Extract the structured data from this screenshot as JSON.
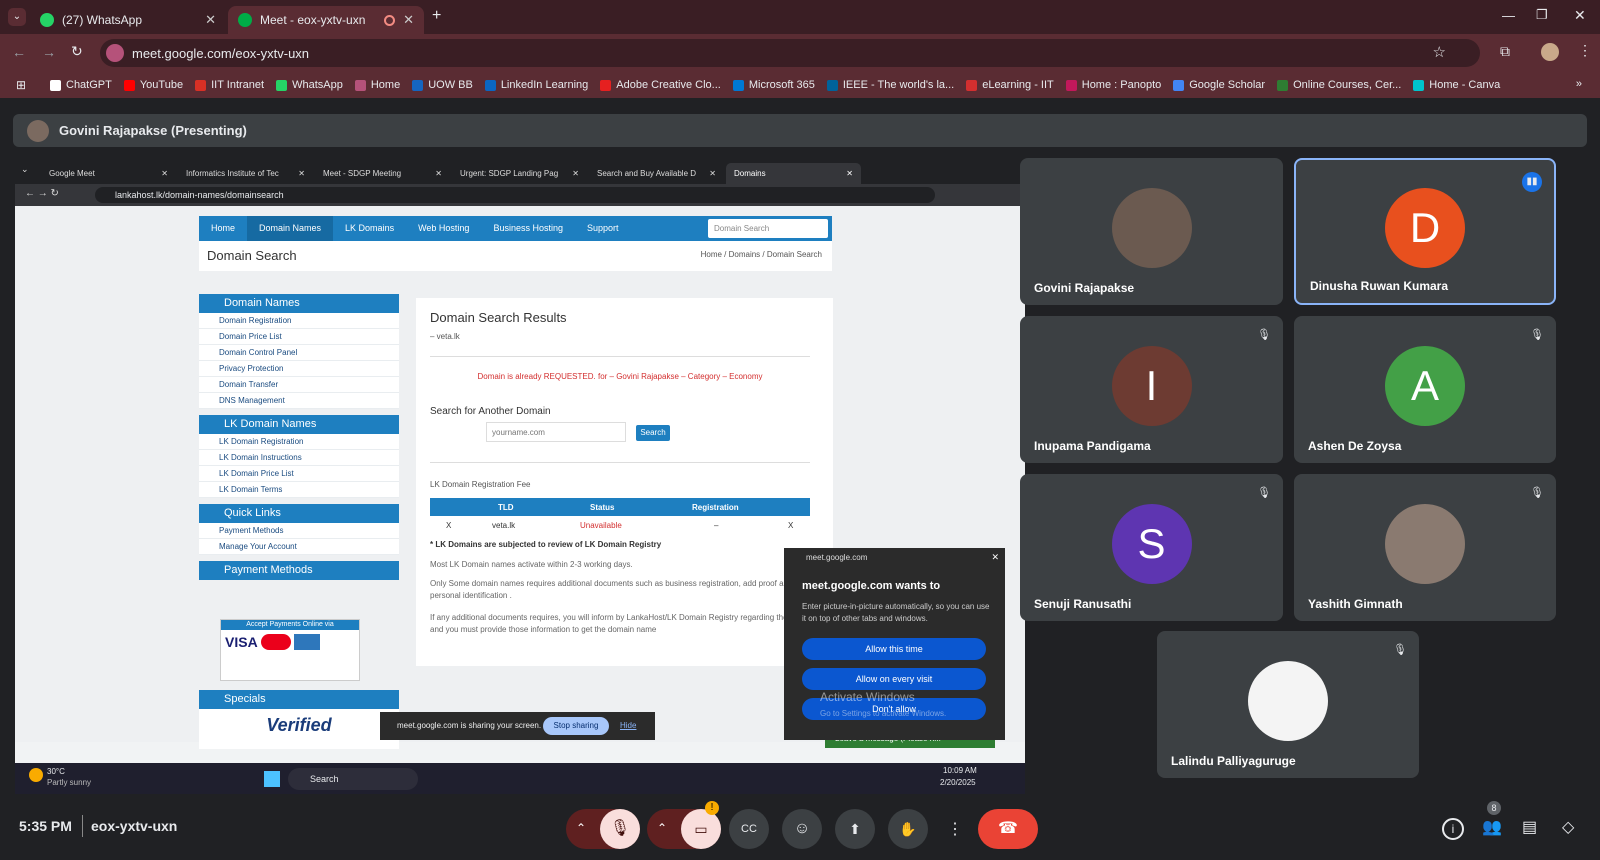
{
  "browser": {
    "tabs": [
      {
        "label": "(27) WhatsApp",
        "color": "#25d366",
        "active": false
      },
      {
        "label": "Meet - eox-yxtv-uxn",
        "color": "#00ac47",
        "active": true
      }
    ],
    "url": "meet.google.com/eox-yxtv-uxn",
    "bookmarks": [
      "ChatGPT",
      "YouTube",
      "IIT Intranet",
      "WhatsApp",
      "Home",
      "UOW BB",
      "LinkedIn Learning",
      "Adobe Creative Clo...",
      "Microsoft 365",
      "IEEE - The world's la...",
      "eLearning - IIT",
      "Home : Panopto",
      "Google Scholar",
      "Online Courses, Cer...",
      "Home - Canva"
    ]
  },
  "meet": {
    "presenter": "Govini Rajapakse (Presenting)",
    "time": "5:35 PM",
    "meeting_code": "eox-yxtv-uxn",
    "people_count": "8",
    "participants": [
      {
        "name": "Govini Rajapakse",
        "initial": "",
        "color": "#6b5a50",
        "muted": false
      },
      {
        "name": "Dinusha Ruwan Kumara",
        "initial": "D",
        "color": "#e8501e",
        "muted": false
      },
      {
        "name": "Inupama Pandigama",
        "initial": "I",
        "color": "#6d3b32",
        "muted": true
      },
      {
        "name": "Ashen De Zoysa",
        "initial": "A",
        "color": "#43a047",
        "muted": true
      },
      {
        "name": "Senuji Ranusathi",
        "initial": "S",
        "color": "#5e35b1",
        "muted": true
      },
      {
        "name": "Yashith Gimnath",
        "initial": "",
        "color": "#8a7a70",
        "muted": true
      },
      {
        "name": "Lalindu Palliyaguruge",
        "initial": "",
        "color": "#f4f4f4",
        "muted": true
      }
    ]
  },
  "shared": {
    "tabs": [
      "Google Meet",
      "Informatics Institute of Tec",
      "Meet - SDGP Meeting",
      "Urgent: SDGP Landing Pag",
      "Search and Buy Available D",
      "Domains"
    ],
    "url": "lankahost.lk/domain-names/domainsearch",
    "nav": [
      "Home",
      "Domain Names",
      "LK Domains",
      "Web Hosting",
      "Business Hosting",
      "Support"
    ],
    "nav_search": "Domain Search",
    "page_title": "Domain Search",
    "breadcrumb": "Home / Domains / Domain Search",
    "side": [
      {
        "head": "Domain Names",
        "items": [
          "Domain Registration",
          "Domain Price List",
          "Domain Control Panel",
          "Privacy Protection",
          "Domain Transfer",
          "DNS Management"
        ]
      },
      {
        "head": "LK Domain Names",
        "items": [
          "LK Domain Registration",
          "LK Domain Instructions",
          "LK Domain Price List",
          "LK Domain Terms"
        ]
      },
      {
        "head": "Quick Links",
        "items": [
          "Payment Methods",
          "Manage Your Account"
        ]
      },
      {
        "head": "Payment Methods",
        "items": []
      }
    ],
    "accept_payments": "Accept Payments Online via",
    "specials": "Specials",
    "verified": "Verified",
    "results_title": "Domain Search Results",
    "results_sub": "– veta.lk",
    "requested_msg": "Domain is already REQUESTED. for – Govini Rajapakse – Category – Economy",
    "search_another": "Search for Another Domain",
    "search_placeholder": "yourname.com",
    "search_btn": "Search",
    "fee_label": "LK Domain Registration Fee",
    "table_headers": [
      "TLD",
      "Status",
      "Registration"
    ],
    "table_row": [
      "X",
      "veta.lk",
      "Unavailable",
      "–",
      "X"
    ],
    "note_bold": "* LK Domains are subjected to review of LK Domain Registry",
    "note1": "Most LK Domain names activate within 2-3 working days.",
    "note2": "Only Some domain names requires additional documents such as business registration, add proof and personal identification .",
    "note3": "If any additional documents requires, you will inform by LankaHost/LK Domain Registry regarding the same and you must provide those information to get the domain name",
    "pip_site": "meet.google.com",
    "pip_title": "meet.google.com wants to",
    "pip_text": "Enter picture-in-picture automatically, so you can use it on top of other tabs and windows.",
    "pip_allow_once": "Allow this time",
    "pip_allow_always": "Allow on every visit",
    "pip_deny": "Don't allow",
    "activate1": "Activate Windows",
    "activate2": "Go to Settings to activate Windows.",
    "sharing_text": "meet.google.com is sharing your screen.",
    "stop_sharing": "Stop sharing",
    "hide": "Hide",
    "leave_msg": "Leave a message (Please n...",
    "weather_temp": "30°C",
    "weather_desc": "Partly sunny",
    "taskbar_search": "Search",
    "task_time": "10:09 AM",
    "task_date": "2/20/2025"
  }
}
